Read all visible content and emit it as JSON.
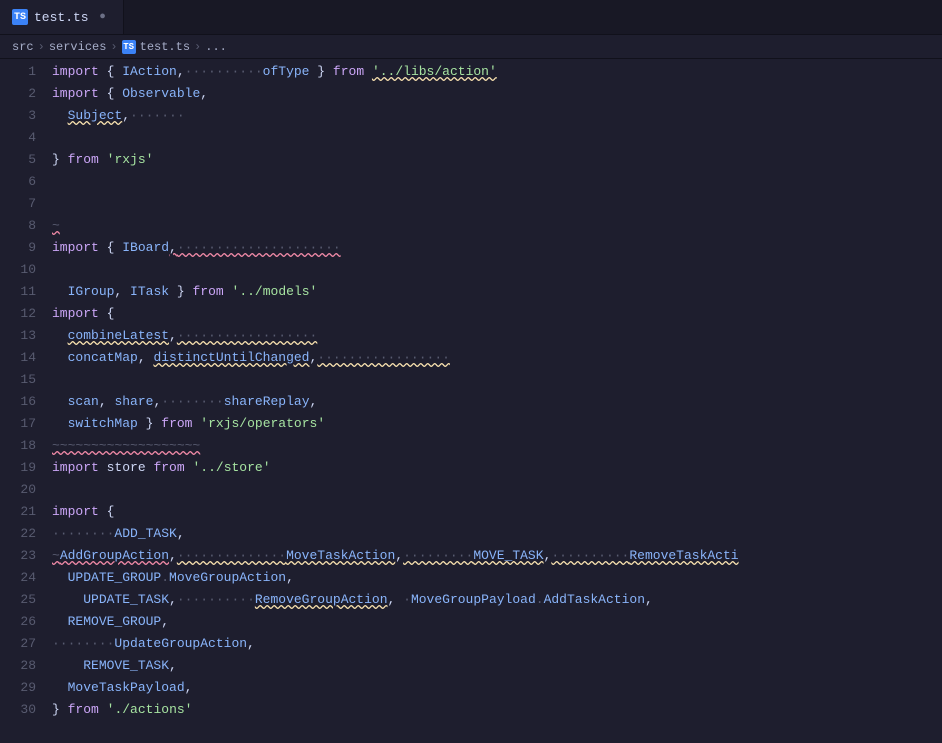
{
  "tab": {
    "icon_label": "TS",
    "filename": "test.ts",
    "close_symbol": "●"
  },
  "breadcrumb": {
    "src": "src",
    "sep1": "›",
    "services": "services",
    "sep2": "›",
    "ts_label": "TS",
    "file": "test.ts",
    "sep3": "›",
    "ellipsis": "..."
  },
  "lines": [
    {
      "num": 1
    },
    {
      "num": 2
    },
    {
      "num": 3
    },
    {
      "num": 4
    },
    {
      "num": 5
    },
    {
      "num": 6
    },
    {
      "num": 7
    },
    {
      "num": 8
    },
    {
      "num": 9
    },
    {
      "num": 10
    },
    {
      "num": 11
    },
    {
      "num": 12
    },
    {
      "num": 13
    },
    {
      "num": 14
    },
    {
      "num": 15
    },
    {
      "num": 16
    },
    {
      "num": 17
    },
    {
      "num": 18
    },
    {
      "num": 19
    },
    {
      "num": 20
    },
    {
      "num": 21
    },
    {
      "num": 22
    },
    {
      "num": 23
    },
    {
      "num": 24
    },
    {
      "num": 25
    },
    {
      "num": 26
    },
    {
      "num": 27
    },
    {
      "num": 28
    },
    {
      "num": 29
    },
    {
      "num": 30
    }
  ]
}
